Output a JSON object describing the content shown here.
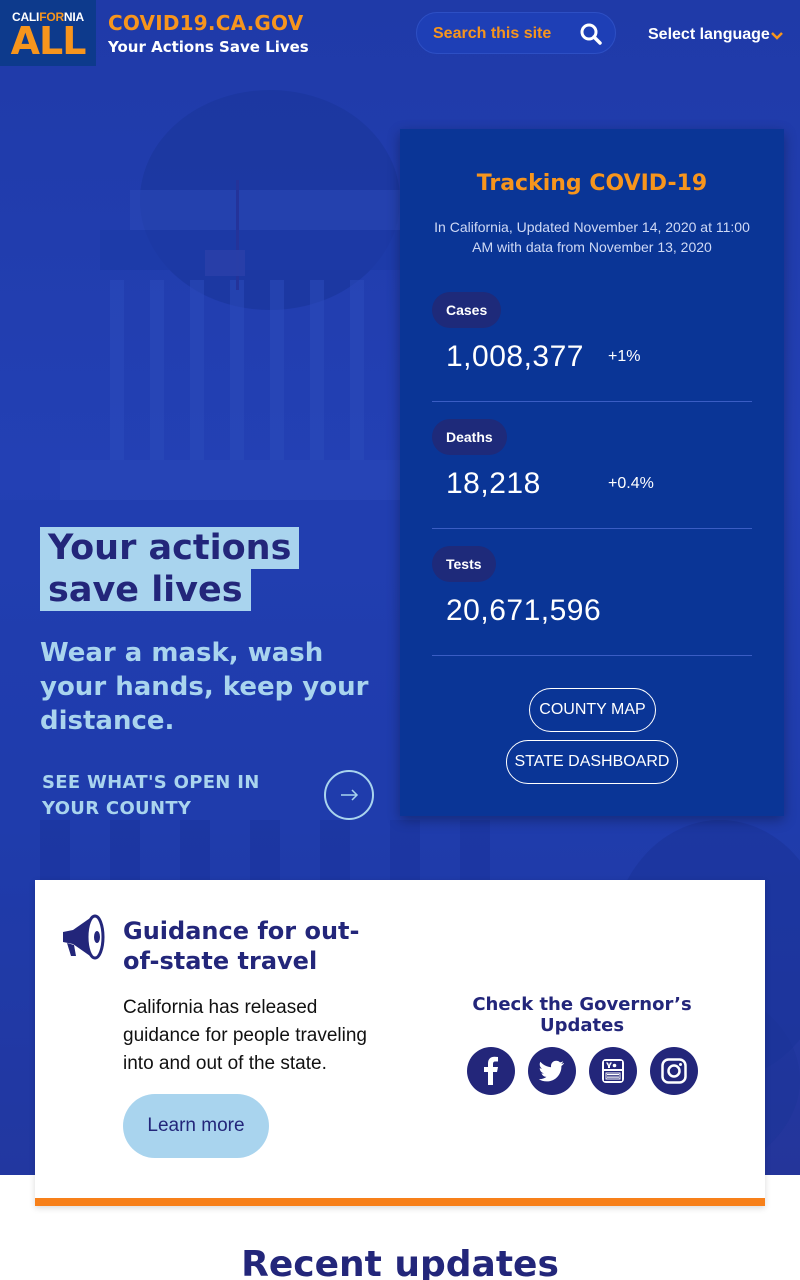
{
  "header": {
    "logo_top_1": "CALI",
    "logo_top_for": "FOR",
    "logo_top_2": "NIA",
    "logo_all": "ALL",
    "site_title": "COVID19.CA.GOV",
    "site_subtitle": "Your Actions Save Lives",
    "search_placeholder": "Search this site",
    "language_label": "Select language"
  },
  "tracking": {
    "title": "Tracking COVID-19",
    "subtitle": "In California, Updated November 14, 2020 at 11:00 AM with data from November 13, 2020",
    "stats": [
      {
        "label": "Cases",
        "value": "1,008,377",
        "change": "+1%"
      },
      {
        "label": "Deaths",
        "value": "18,218",
        "change": "+0.4%"
      },
      {
        "label": "Tests",
        "value": "20,671,596",
        "change": ""
      }
    ],
    "county_map_label": "COUNTY MAP",
    "state_dashboard_label": "STATE DASHBOARD"
  },
  "hero": {
    "headline_line1": "Your actions",
    "headline_line2": "save lives",
    "subheadline": "Wear a mask, wash your hands, keep your distance.",
    "county_link": "SEE WHAT'S OPEN IN YOUR COUNTY"
  },
  "guidance": {
    "title": "Guidance for out-of-state travel",
    "body": "California has released guidance for people traveling into and out of the state.",
    "learn_more_label": "Learn more",
    "governor_updates": "Check the Governor’s Updates",
    "social": [
      "facebook-icon",
      "twitter-icon",
      "youtube-icon",
      "instagram-icon"
    ]
  },
  "recent": {
    "title": "Recent updates"
  },
  "colors": {
    "brand_orange": "#f7951d",
    "navy": "#23267a",
    "light_blue": "#a9d4ee",
    "card_blue": "#0a3596"
  }
}
